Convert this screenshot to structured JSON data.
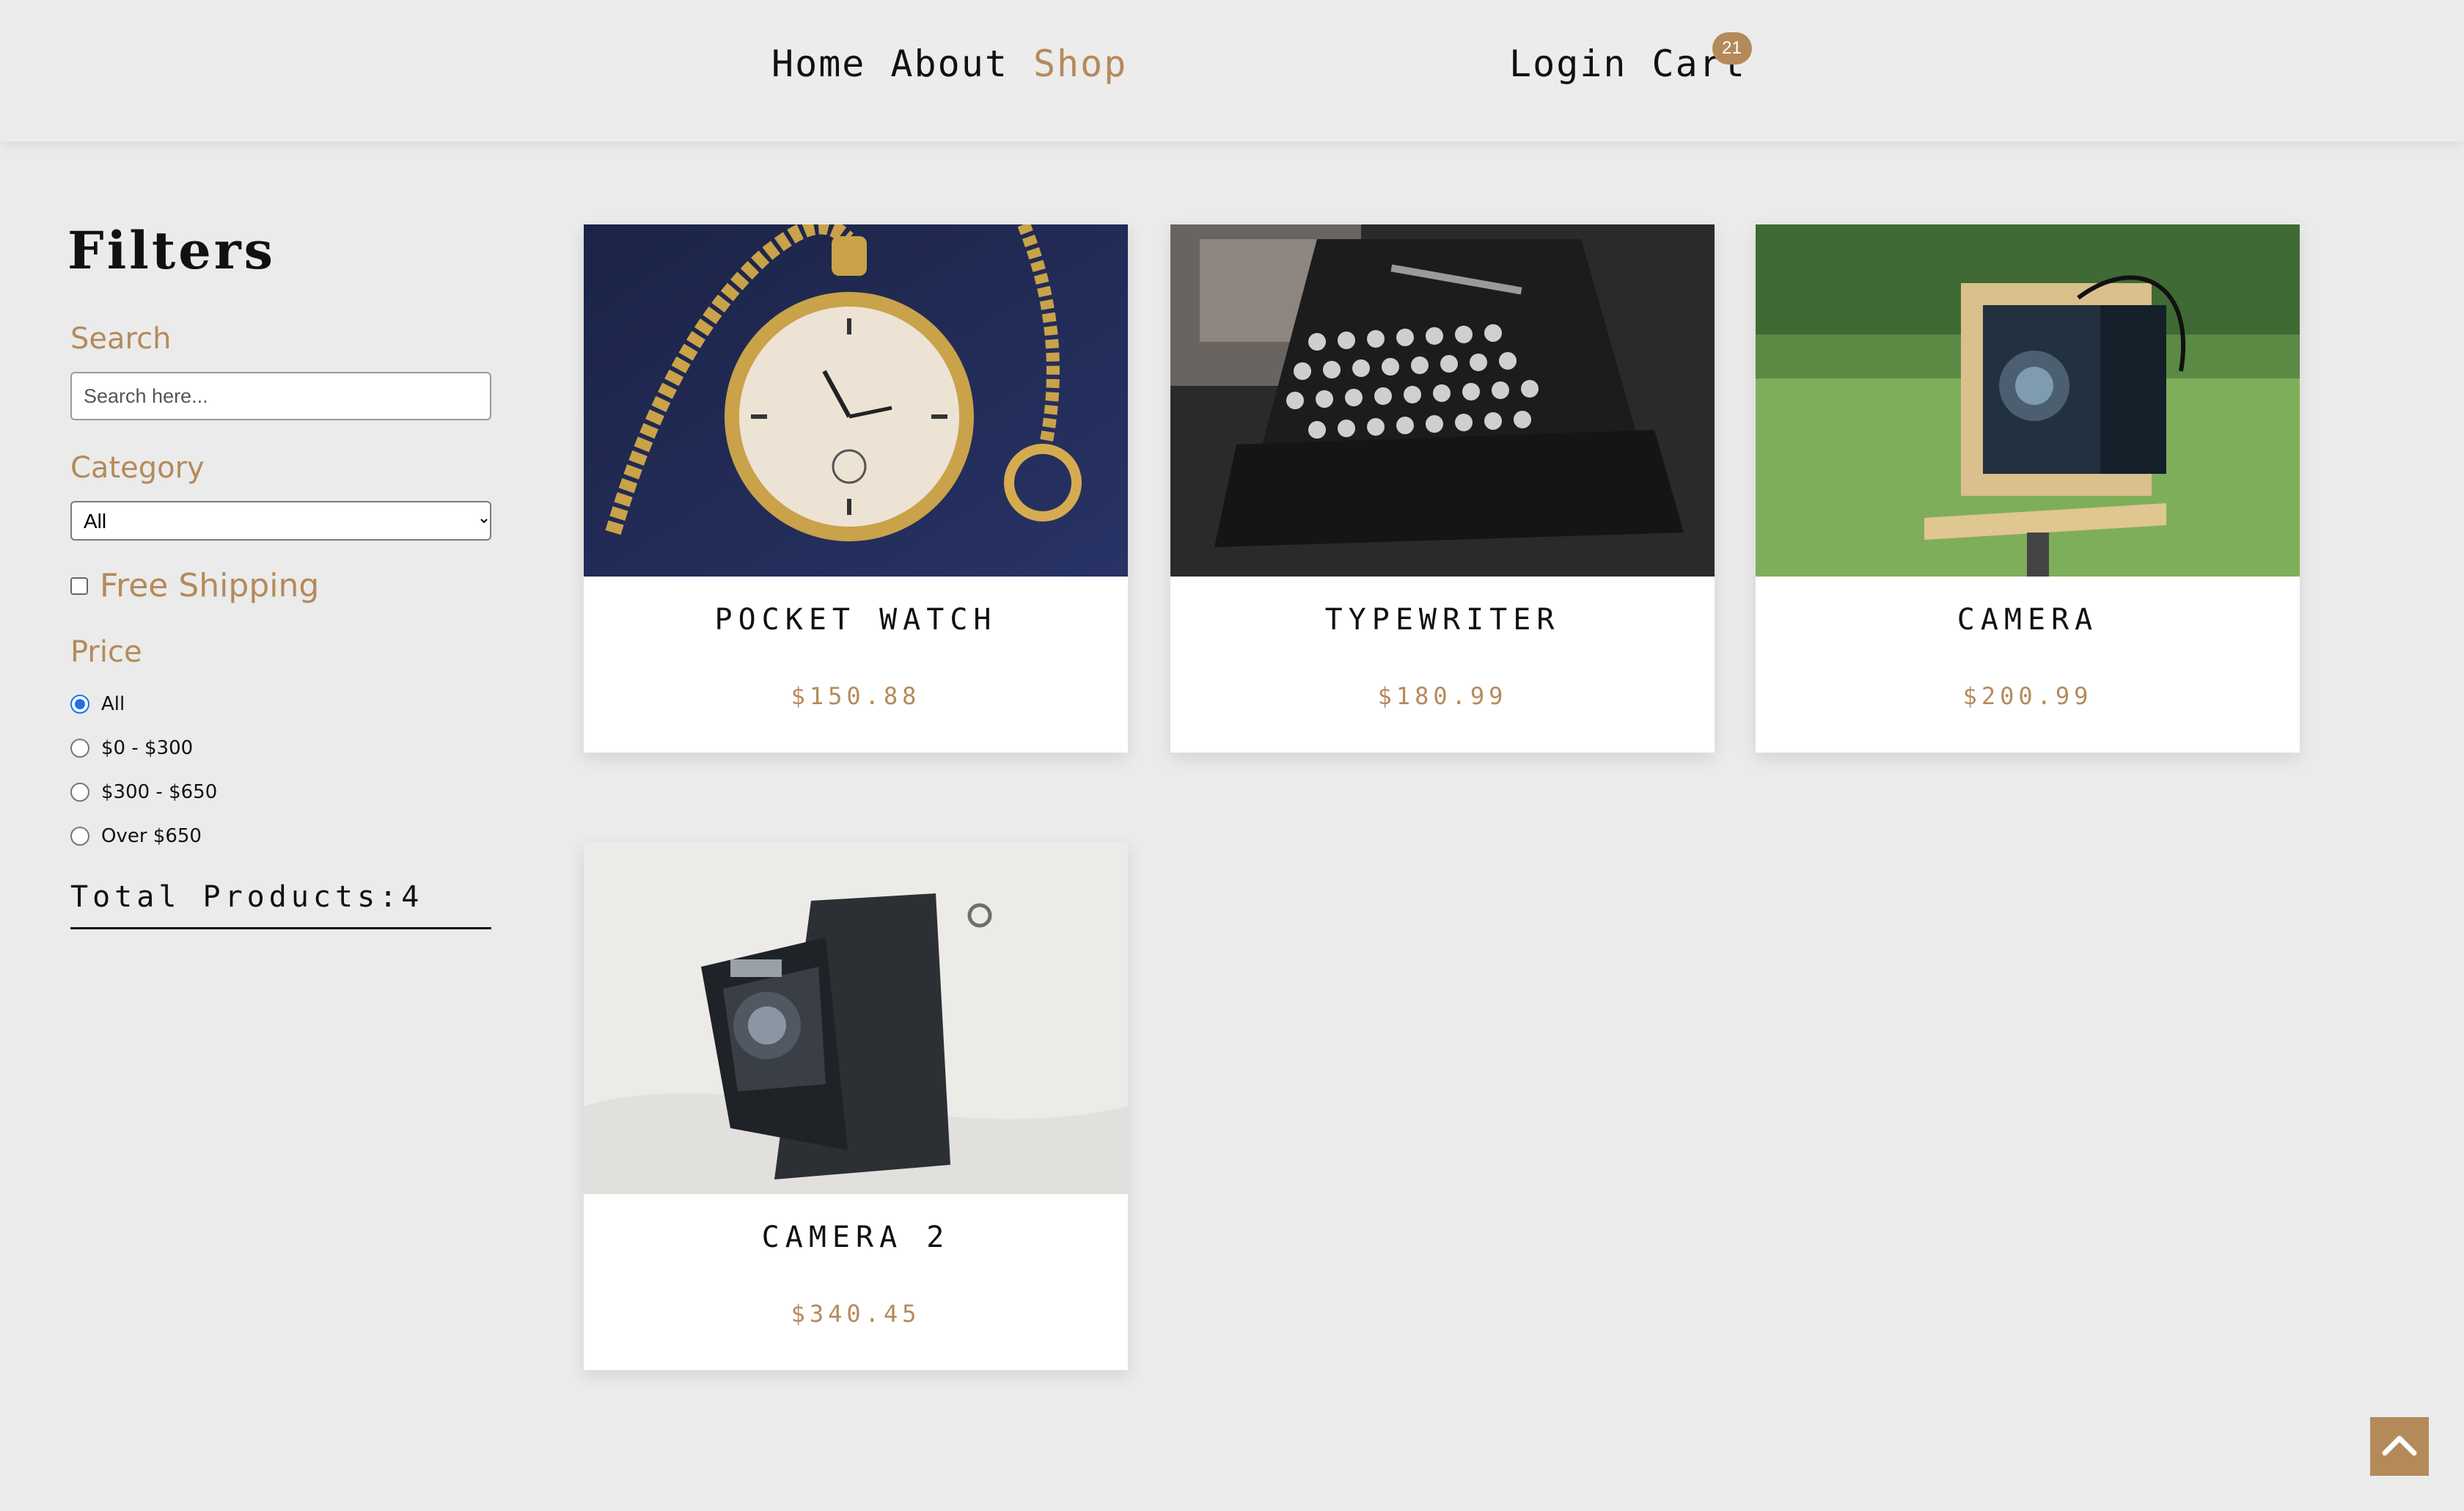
{
  "nav": {
    "home": "Home",
    "about": "About",
    "shop": "Shop",
    "login": "Login",
    "cart": "Cart",
    "cart_count": "21",
    "active": "Shop"
  },
  "filters": {
    "title": "Filters",
    "search_label": "Search",
    "search_placeholder": "Search here...",
    "search_value": "",
    "category_label": "Category",
    "category_selected": "All",
    "free_shipping_label": "Free Shipping",
    "free_shipping_checked": false,
    "price_label": "Price",
    "price_options": [
      "All",
      "$0 - $300",
      "$300 - $650",
      "Over $650"
    ],
    "price_selected": "All",
    "total_products": "Total Products:4"
  },
  "products": [
    {
      "name": "POCKET WATCH",
      "price": "$150.88",
      "image": "pocket-watch"
    },
    {
      "name": "TYPEWRITER",
      "price": "$180.99",
      "image": "typewriter"
    },
    {
      "name": "CAMERA",
      "price": "$200.99",
      "image": "camera"
    },
    {
      "name": "CAMERA 2",
      "price": "$340.45",
      "image": "camera-2"
    }
  ],
  "colors": {
    "accent": "#b58a5a",
    "background": "#ebebeb",
    "radio_selected": "#1a73e8"
  },
  "icons": {
    "scroll_top": "chevron-up-icon"
  }
}
